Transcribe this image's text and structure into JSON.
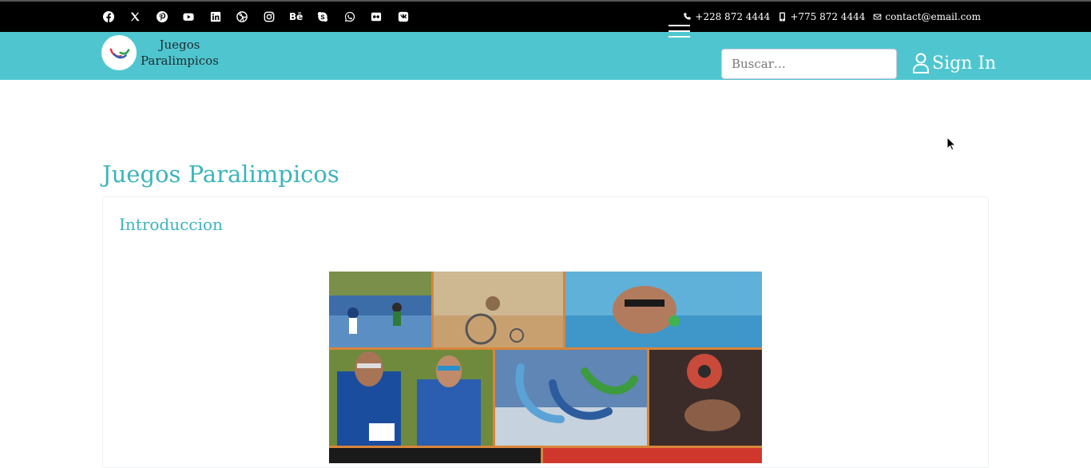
{
  "topbar": {
    "social_icons": [
      "facebook-icon",
      "x-twitter-icon",
      "pinterest-icon",
      "youtube-icon",
      "linkedin-icon",
      "dribbble-icon",
      "instagram-icon",
      "behance-icon",
      "skype-icon",
      "whatsapp-icon",
      "flickr-icon",
      "vk-icon"
    ],
    "behance_label": "Bē",
    "phone": "+228 872 4444",
    "mobile": "+775 872 4444",
    "email": "contact@email.com"
  },
  "navbar": {
    "brand_line1": "Juegos",
    "brand_line2": "Paralimpicos",
    "search_placeholder": "Buscar…",
    "signin_label": "Sign In",
    "background_color": "#4fc6cf"
  },
  "main": {
    "page_title": "Juegos Paralimpicos",
    "section_title": "Introduccion",
    "accent_color": "#3cb4bd"
  }
}
